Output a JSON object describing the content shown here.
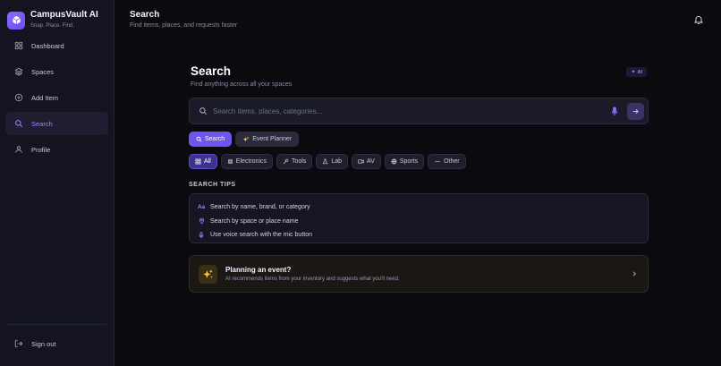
{
  "brand": {
    "title": "CampusVault AI",
    "subtitle": "Snap. Place. Find."
  },
  "nav": {
    "items": [
      {
        "label": "Dashboard",
        "icon": "grid-icon",
        "active": false
      },
      {
        "label": "Spaces",
        "icon": "layers-icon",
        "active": false
      },
      {
        "label": "Add Item",
        "icon": "plus-circle-icon",
        "active": false
      },
      {
        "label": "Search",
        "icon": "search-icon",
        "active": true
      },
      {
        "label": "Profile",
        "icon": "user-icon",
        "active": false
      }
    ],
    "signout": "Sign out"
  },
  "header": {
    "title": "Search",
    "subtitle": "Find items, places, and requests faster"
  },
  "main": {
    "title": "Search",
    "subtitle": "Find anything across all your spaces",
    "ai_badge": "AI",
    "search": {
      "placeholder": "Search items, places, categories...",
      "value": ""
    },
    "modes": [
      {
        "label": "Search",
        "active": true
      },
      {
        "label": "Event Planner",
        "active": false
      }
    ],
    "chips": [
      {
        "label": "All",
        "icon": "grid-icon",
        "active": true
      },
      {
        "label": "Electronics",
        "icon": "chip-icon",
        "active": false
      },
      {
        "label": "Tools",
        "icon": "wrench-icon",
        "active": false
      },
      {
        "label": "Lab",
        "icon": "flask-icon",
        "active": false
      },
      {
        "label": "AV",
        "icon": "video-icon",
        "active": false
      },
      {
        "label": "Sports",
        "icon": "ball-icon",
        "active": false
      },
      {
        "label": "Other",
        "icon": "more-icon",
        "active": false
      }
    ],
    "tips_heading": "SEARCH TIPS",
    "tips": [
      {
        "icon_text": "Aa",
        "text": "Search by name, brand, or category"
      },
      {
        "icon": "pin-icon",
        "text": "Search by space or place name"
      },
      {
        "icon": "mic-icon",
        "text": "Use voice search with the mic button"
      }
    ],
    "event": {
      "title": "Planning an event?",
      "description": "AI recommends items from your inventory and suggests what you'll need."
    }
  },
  "colors": {
    "accent": "#6d55f0",
    "accent_text": "#9d86ff",
    "background": "#0a0a0f",
    "sidebar": "#141420",
    "event_icon": "#f5c542"
  }
}
